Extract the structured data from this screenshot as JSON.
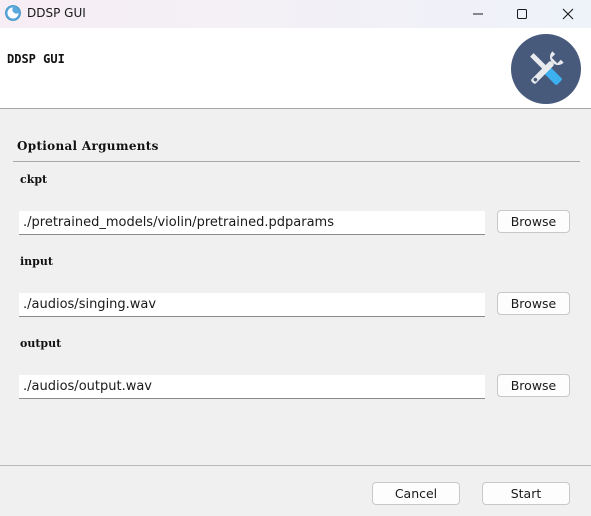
{
  "window": {
    "title": "DDSP GUI",
    "icon": "app-logo-icon",
    "controls": {
      "minimize": "minimize-icon",
      "maximize": "maximize-icon",
      "close": "close-icon"
    }
  },
  "header": {
    "title": "DDSP GUI",
    "logo": "tools-icon",
    "logo_color": "#475a7c"
  },
  "section": {
    "title": "Optional Arguments"
  },
  "fields": [
    {
      "label": "ckpt",
      "value": "./pretrained_models/violin/pretrained.pdparams",
      "button": "Browse"
    },
    {
      "label": "input",
      "value": "./audios/singing.wav",
      "button": "Browse"
    },
    {
      "label": "output",
      "value": "./audios/output.wav",
      "button": "Browse"
    }
  ],
  "footer": {
    "cancel_label": "Cancel",
    "start_label": "Start"
  }
}
